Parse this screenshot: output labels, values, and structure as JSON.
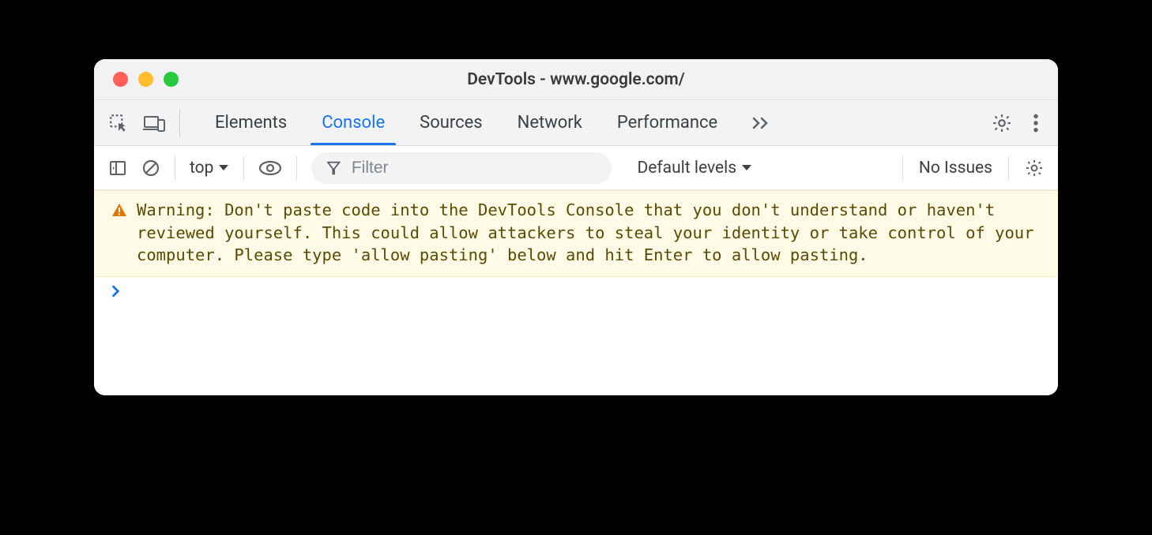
{
  "window": {
    "title": "DevTools - www.google.com/"
  },
  "tabs": {
    "items": [
      "Elements",
      "Console",
      "Sources",
      "Network",
      "Performance"
    ],
    "active_index": 1,
    "overflow_glyph": "≫"
  },
  "filter": {
    "context": "top",
    "filter_placeholder": "Filter",
    "levels_label": "Default levels",
    "issues_label": "No Issues"
  },
  "console": {
    "warning_text": "Warning: Don't paste code into the DevTools Console that you don't understand or haven't reviewed yourself. This could allow attackers to steal your identity or take control of your computer. Please type 'allow pasting' below and hit Enter to allow pasting."
  }
}
